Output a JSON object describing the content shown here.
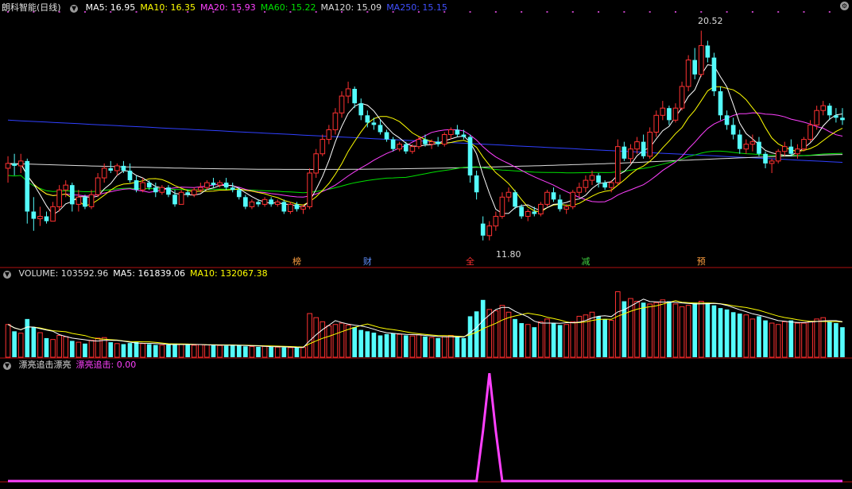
{
  "main": {
    "title": "朗科智能(日线)",
    "ma_labels": [
      {
        "text": "MA5: 16.95",
        "color": "#ffffff"
      },
      {
        "text": "MA10: 16.35",
        "color": "#ffff00"
      },
      {
        "text": "MA20: 15.93",
        "color": "#ff40ff"
      },
      {
        "text": "MA60: 15.22",
        "color": "#00e000"
      },
      {
        "text": "MA120: 15.09",
        "color": "#dddddd"
      },
      {
        "text": "MA250: 15.15",
        "color": "#4050ff"
      }
    ],
    "high_label": "20.52",
    "low_label": "11.80",
    "event_marks": [
      {
        "text": "榜",
        "color": "#ffa040"
      },
      {
        "text": "财",
        "color": "#6090ff"
      },
      {
        "text": "全",
        "color": "#ff3030"
      },
      {
        "text": "减",
        "color": "#40d040"
      },
      {
        "text": "预",
        "color": "#ffa040"
      }
    ]
  },
  "volume": {
    "labels": [
      {
        "text": "VOLUME: 103592.96",
        "color": "#dddddd"
      },
      {
        "text": "MA5: 161839.06",
        "color": "#ffffff"
      },
      {
        "text": "MA10: 132067.38",
        "color": "#ffff00"
      }
    ]
  },
  "indicator": {
    "labels": [
      {
        "text": "漂亮追击漂亮",
        "color": "#dddddd"
      },
      {
        "text": "漂亮追击: 0.00",
        "color": "#ff40ff"
      }
    ]
  },
  "colors": {
    "up": "#ff3232",
    "down": "#54fcfc",
    "ma5": "#ffffff",
    "ma10": "#ffff00",
    "ma20": "#ff40ff",
    "ma60": "#00e000",
    "ma120": "#dddddd",
    "ma250": "#3040ff"
  },
  "chart_data": {
    "type": "candlestick",
    "price_range": [
      11.3,
      21.2
    ],
    "candles": [
      [
        14.8,
        15.3,
        14.2,
        15.0
      ],
      [
        15.0,
        15.4,
        14.5,
        14.9
      ],
      [
        14.9,
        15.4,
        14.6,
        15.1
      ],
      [
        15.1,
        15.2,
        12.5,
        13.0
      ],
      [
        13.0,
        13.6,
        12.2,
        12.7
      ],
      [
        12.7,
        13.2,
        12.4,
        12.8
      ],
      [
        12.8,
        13.0,
        12.5,
        12.6
      ],
      [
        12.6,
        13.4,
        12.6,
        13.2
      ],
      [
        13.2,
        14.1,
        13.0,
        13.9
      ],
      [
        13.9,
        14.3,
        13.6,
        14.1
      ],
      [
        14.1,
        14.2,
        13.0,
        13.3
      ],
      [
        13.3,
        13.9,
        13.0,
        13.6
      ],
      [
        13.6,
        13.7,
        13.1,
        13.2
      ],
      [
        13.2,
        13.9,
        13.1,
        13.7
      ],
      [
        13.7,
        14.6,
        13.6,
        14.4
      ],
      [
        14.4,
        15.0,
        14.2,
        14.8
      ],
      [
        14.8,
        15.1,
        14.6,
        14.7
      ],
      [
        14.7,
        15.0,
        14.5,
        14.9
      ],
      [
        14.9,
        15.1,
        14.6,
        14.7
      ],
      [
        14.7,
        15.0,
        14.2,
        14.3
      ],
      [
        14.3,
        14.5,
        13.8,
        13.9
      ],
      [
        13.9,
        14.4,
        13.8,
        14.2
      ],
      [
        14.2,
        14.3,
        13.9,
        14.0
      ],
      [
        14.0,
        14.2,
        13.6,
        13.8
      ],
      [
        13.8,
        14.1,
        13.7,
        14.0
      ],
      [
        14.0,
        14.1,
        13.6,
        13.7
      ],
      [
        13.7,
        13.9,
        13.2,
        13.3
      ],
      [
        13.3,
        13.9,
        13.3,
        13.8
      ],
      [
        13.8,
        13.9,
        13.6,
        13.7
      ],
      [
        13.7,
        14.0,
        13.6,
        13.9
      ],
      [
        13.9,
        14.2,
        13.8,
        14.0
      ],
      [
        14.0,
        14.3,
        13.9,
        14.2
      ],
      [
        14.2,
        14.4,
        14.0,
        14.1
      ],
      [
        14.1,
        14.3,
        14.0,
        14.2
      ],
      [
        14.2,
        14.4,
        13.9,
        14.0
      ],
      [
        14.0,
        14.2,
        13.8,
        13.9
      ],
      [
        13.9,
        14.0,
        13.5,
        13.6
      ],
      [
        13.6,
        13.7,
        13.1,
        13.2
      ],
      [
        13.2,
        13.5,
        13.1,
        13.4
      ],
      [
        13.4,
        13.5,
        13.2,
        13.3
      ],
      [
        13.3,
        13.6,
        13.2,
        13.5
      ],
      [
        13.5,
        13.6,
        13.2,
        13.3
      ],
      [
        13.3,
        13.5,
        13.2,
        13.4
      ],
      [
        13.4,
        13.5,
        12.9,
        13.0
      ],
      [
        13.0,
        13.4,
        12.9,
        13.3
      ],
      [
        13.3,
        13.4,
        13.0,
        13.1
      ],
      [
        13.1,
        13.3,
        12.9,
        13.2
      ],
      [
        13.2,
        14.8,
        13.1,
        14.6
      ],
      [
        14.6,
        15.6,
        14.4,
        15.4
      ],
      [
        15.4,
        16.2,
        15.3,
        16.0
      ],
      [
        16.0,
        16.6,
        15.8,
        16.4
      ],
      [
        16.4,
        17.3,
        16.2,
        17.1
      ],
      [
        17.1,
        18.0,
        16.9,
        17.8
      ],
      [
        17.8,
        18.4,
        17.5,
        18.1
      ],
      [
        18.1,
        18.2,
        17.3,
        17.5
      ],
      [
        17.5,
        17.7,
        16.8,
        17.0
      ],
      [
        17.0,
        17.2,
        16.5,
        16.7
      ],
      [
        16.7,
        16.9,
        16.4,
        16.6
      ],
      [
        16.6,
        16.8,
        16.2,
        16.3
      ],
      [
        16.3,
        16.4,
        15.9,
        16.0
      ],
      [
        16.0,
        16.1,
        15.5,
        15.6
      ],
      [
        15.6,
        15.9,
        15.5,
        15.8
      ],
      [
        15.8,
        15.9,
        15.4,
        15.5
      ],
      [
        15.5,
        15.8,
        15.4,
        15.7
      ],
      [
        15.7,
        16.1,
        15.6,
        16.0
      ],
      [
        16.0,
        16.2,
        15.7,
        15.8
      ],
      [
        15.8,
        16.0,
        15.6,
        15.9
      ],
      [
        15.9,
        16.1,
        15.7,
        15.8
      ],
      [
        15.8,
        16.3,
        15.7,
        16.2
      ],
      [
        16.2,
        16.5,
        16.0,
        16.4
      ],
      [
        16.4,
        16.6,
        16.1,
        16.2
      ],
      [
        16.2,
        16.4,
        16.0,
        16.1
      ],
      [
        16.1,
        16.2,
        14.2,
        14.5
      ],
      [
        14.5,
        14.7,
        13.5,
        13.8
      ],
      [
        12.5,
        12.8,
        11.8,
        12.0
      ],
      [
        12.0,
        12.6,
        11.8,
        12.4
      ],
      [
        12.4,
        13.0,
        12.2,
        12.8
      ],
      [
        12.8,
        13.8,
        12.7,
        13.6
      ],
      [
        13.6,
        14.0,
        13.4,
        13.8
      ],
      [
        13.8,
        13.9,
        13.1,
        13.2
      ],
      [
        13.2,
        13.3,
        12.7,
        12.8
      ],
      [
        12.8,
        13.1,
        12.6,
        13.0
      ],
      [
        13.0,
        13.2,
        12.8,
        12.9
      ],
      [
        12.9,
        13.4,
        12.8,
        13.3
      ],
      [
        13.3,
        13.9,
        13.2,
        13.8
      ],
      [
        13.8,
        14.0,
        13.4,
        13.5
      ],
      [
        13.5,
        13.7,
        13.0,
        13.1
      ],
      [
        13.1,
        13.3,
        12.9,
        13.2
      ],
      [
        13.2,
        13.9,
        13.1,
        13.8
      ],
      [
        13.8,
        14.2,
        13.6,
        14.0
      ],
      [
        14.0,
        14.5,
        13.8,
        14.3
      ],
      [
        14.3,
        14.7,
        14.1,
        14.5
      ],
      [
        14.5,
        14.6,
        14.0,
        14.2
      ],
      [
        14.2,
        14.3,
        13.9,
        14.0
      ],
      [
        14.0,
        14.3,
        13.8,
        14.2
      ],
      [
        14.2,
        16.0,
        14.1,
        15.7
      ],
      [
        15.7,
        15.9,
        15.1,
        15.2
      ],
      [
        15.2,
        15.8,
        15.0,
        15.6
      ],
      [
        15.6,
        16.1,
        15.4,
        15.9
      ],
      [
        15.9,
        16.2,
        15.2,
        15.3
      ],
      [
        15.3,
        16.5,
        15.2,
        16.3
      ],
      [
        16.3,
        17.2,
        16.1,
        17.0
      ],
      [
        17.0,
        17.6,
        16.8,
        17.3
      ],
      [
        17.3,
        17.4,
        16.6,
        16.8
      ],
      [
        16.8,
        17.5,
        16.7,
        17.3
      ],
      [
        17.3,
        18.4,
        17.2,
        18.2
      ],
      [
        18.2,
        19.5,
        18.0,
        19.3
      ],
      [
        19.3,
        19.8,
        18.5,
        18.7
      ],
      [
        18.7,
        20.52,
        18.6,
        19.9
      ],
      [
        19.9,
        20.1,
        19.2,
        19.4
      ],
      [
        19.4,
        19.6,
        17.8,
        18.0
      ],
      [
        18.0,
        18.2,
        16.8,
        17.0
      ],
      [
        17.0,
        17.2,
        16.4,
        16.6
      ],
      [
        16.6,
        16.9,
        16.0,
        16.2
      ],
      [
        16.2,
        16.4,
        15.4,
        15.6
      ],
      [
        15.6,
        16.0,
        15.4,
        15.8
      ],
      [
        15.8,
        16.2,
        15.5,
        15.9
      ],
      [
        15.9,
        16.1,
        15.3,
        15.4
      ],
      [
        15.4,
        15.5,
        14.8,
        15.0
      ],
      [
        15.0,
        15.2,
        14.6,
        15.1
      ],
      [
        15.1,
        15.6,
        15.0,
        15.5
      ],
      [
        15.5,
        15.9,
        15.3,
        15.7
      ],
      [
        15.7,
        16.0,
        15.3,
        15.4
      ],
      [
        15.4,
        15.8,
        15.2,
        15.6
      ],
      [
        15.6,
        16.1,
        15.5,
        16.0
      ],
      [
        16.0,
        16.8,
        15.9,
        16.6
      ],
      [
        16.6,
        17.4,
        16.4,
        17.2
      ],
      [
        17.2,
        17.6,
        17.0,
        17.4
      ],
      [
        17.4,
        17.5,
        16.8,
        17.0
      ],
      [
        17.0,
        17.3,
        16.7,
        16.9
      ],
      [
        16.9,
        17.3,
        16.6,
        16.8
      ]
    ],
    "volumes": [
      [
        0,
        0
      ],
      [
        0,
        0
      ],
      [
        0,
        0
      ],
      [
        0,
        0
      ],
      [
        0,
        0
      ],
      [
        0,
        0
      ],
      [
        0,
        0
      ],
      [
        0,
        0
      ],
      [
        0,
        0
      ],
      [
        0,
        0
      ],
      [
        0,
        0
      ],
      [
        0,
        0
      ],
      [
        0,
        0
      ],
      [
        0,
        0
      ],
      [
        0,
        0
      ],
      [
        0,
        0
      ],
      [
        0,
        0
      ],
      [
        0,
        0
      ],
      [
        0,
        0
      ],
      [
        0,
        0
      ],
      [
        0,
        0
      ],
      [
        0,
        0
      ],
      [
        0,
        0
      ],
      [
        0,
        0
      ],
      [
        0,
        0
      ],
      [
        0,
        0
      ],
      [
        0,
        0
      ],
      [
        0,
        0
      ],
      [
        0,
        0
      ],
      [
        0,
        0
      ],
      [
        0,
        0
      ],
      [
        0,
        0
      ],
      [
        0,
        0
      ],
      [
        0,
        0
      ],
      [
        0,
        0
      ],
      [
        0,
        0
      ],
      [
        0,
        0
      ],
      [
        0,
        0
      ],
      [
        0,
        0
      ],
      [
        0,
        0
      ],
      [
        0,
        0
      ],
      [
        0,
        0
      ],
      [
        0,
        0
      ],
      [
        0,
        0
      ],
      [
        0,
        0
      ],
      [
        0,
        0
      ],
      [
        0,
        0
      ],
      [
        0,
        0
      ],
      [
        0,
        0
      ],
      [
        0,
        0
      ],
      [
        0,
        0
      ],
      [
        0,
        0
      ],
      [
        0,
        0
      ],
      [
        0,
        0
      ],
      [
        0,
        0
      ],
      [
        0,
        0
      ],
      [
        0,
        0
      ],
      [
        0,
        0
      ],
      [
        0,
        0
      ],
      [
        0,
        0
      ],
      [
        0,
        0
      ],
      [
        0,
        0
      ],
      [
        0,
        0
      ],
      [
        0,
        0
      ],
      [
        0,
        0
      ],
      [
        0,
        0
      ],
      [
        0,
        0
      ],
      [
        0,
        0
      ],
      [
        0,
        0
      ],
      [
        0,
        0
      ],
      [
        0,
        0
      ],
      [
        0,
        0
      ],
      [
        0,
        0
      ],
      [
        0,
        0
      ],
      [
        0,
        0
      ],
      [
        0,
        0
      ],
      [
        0,
        0
      ],
      [
        0,
        0
      ],
      [
        0,
        0
      ],
      [
        0,
        0
      ],
      [
        0,
        0
      ],
      [
        0,
        0
      ],
      [
        0,
        0
      ],
      [
        0,
        0
      ],
      [
        0,
        0
      ],
      [
        0,
        0
      ],
      [
        0,
        0
      ],
      [
        0,
        0
      ],
      [
        0,
        0
      ],
      [
        0,
        0
      ],
      [
        0,
        0
      ],
      [
        0,
        0
      ],
      [
        0,
        0
      ],
      [
        0,
        0
      ],
      [
        0,
        0
      ],
      [
        0,
        0
      ],
      [
        0,
        0
      ],
      [
        0,
        0
      ],
      [
        0,
        0
      ],
      [
        0,
        0
      ],
      [
        0,
        0
      ],
      [
        0,
        0
      ],
      [
        0,
        0
      ],
      [
        0,
        0
      ],
      [
        0,
        0
      ],
      [
        0,
        0
      ],
      [
        0,
        0
      ],
      [
        0,
        0
      ],
      [
        0,
        0
      ],
      [
        0,
        0
      ],
      [
        0,
        0
      ],
      [
        0,
        0
      ],
      [
        0,
        0
      ],
      [
        0,
        0
      ],
      [
        0,
        0
      ],
      [
        0,
        0
      ],
      [
        0,
        0
      ],
      [
        0,
        0
      ],
      [
        0,
        0
      ],
      [
        0,
        0
      ],
      [
        0,
        0
      ],
      [
        0,
        0
      ],
      [
        0,
        0
      ],
      [
        0,
        0
      ],
      [
        0,
        0
      ],
      [
        0,
        0
      ],
      [
        0,
        0
      ],
      [
        0,
        0
      ],
      [
        0,
        0
      ],
      [
        0,
        0
      ],
      [
        0,
        0
      ]
    ],
    "volume_values": [
      120000,
      95000,
      88000,
      140000,
      110000,
      90000,
      70000,
      65000,
      80000,
      75000,
      60000,
      55000,
      50000,
      62000,
      70000,
      72000,
      55000,
      50000,
      48000,
      52000,
      56000,
      50000,
      48000,
      45000,
      44000,
      46000,
      50000,
      47000,
      45000,
      44000,
      46000,
      45000,
      44000,
      43000,
      42000,
      45000,
      44000,
      40000,
      39000,
      38000,
      40000,
      38000,
      37000,
      36000,
      35000,
      35000,
      36000,
      160000,
      145000,
      130000,
      115000,
      120000,
      125000,
      118000,
      110000,
      100000,
      95000,
      90000,
      80000,
      85000,
      88000,
      84000,
      80000,
      78000,
      82000,
      76000,
      72000,
      70000,
      75000,
      80000,
      74000,
      70000,
      150000,
      168000,
      210000,
      175000,
      170000,
      190000,
      165000,
      140000,
      125000,
      120000,
      110000,
      130000,
      140000,
      125000,
      118000,
      120000,
      130000,
      150000,
      155000,
      165000,
      150000,
      140000,
      135000,
      240000,
      205000,
      215000,
      205000,
      200000,
      195000,
      200000,
      210000,
      205000,
      195000,
      185000,
      190000,
      200000,
      205000,
      200000,
      190000,
      180000,
      175000,
      165000,
      160000,
      155000,
      140000,
      150000,
      135000,
      125000,
      120000,
      130000,
      135000,
      125000,
      125000,
      130000,
      140000,
      145000,
      130000,
      125000,
      110000
    ],
    "volume_range": [
      0,
      285000
    ],
    "indicator_values": "peak at 0.75 of pane height around candle 75; zero elsewhere",
    "indicator_peak_index": 75,
    "indicator_range": [
      0,
      1
    ]
  }
}
